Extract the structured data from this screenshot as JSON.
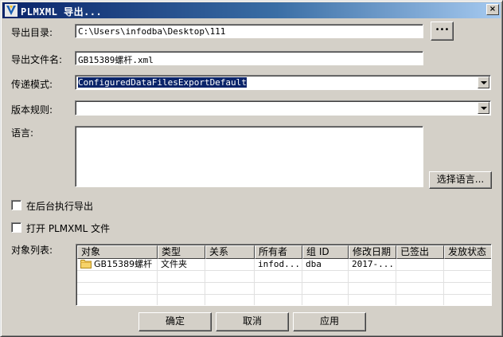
{
  "window": {
    "title": "PLMXML 导出...",
    "close_label": "×"
  },
  "form": {
    "export_dir_label": "导出目录:",
    "export_dir_value": "C:\\Users\\infodba\\Desktop\\111",
    "browse_label": "•••",
    "export_filename_label": "导出文件名:",
    "export_filename_value": "GB15389螺杆.xml",
    "transfer_mode_label": "传递模式:",
    "transfer_mode_value": "ConfiguredDataFilesExportDefault",
    "revision_rule_label": "版本规则:",
    "revision_rule_value": "",
    "language_label": "语言:",
    "select_language_label": "选择语言...",
    "background_checkbox_label": "在后台执行导出",
    "open_file_checkbox_label": "打开 PLMXML 文件",
    "object_list_label": "对象列表:"
  },
  "table": {
    "columns": [
      "对象",
      "类型",
      "关系",
      "所有者",
      "组 ID",
      "修改日期",
      "已签出",
      "发放状态"
    ],
    "rows": [
      [
        "GB15389螺杆",
        "文件夹",
        "",
        "infod...",
        "dba",
        "2017-...",
        "",
        ""
      ]
    ]
  },
  "buttons": {
    "ok": "确定",
    "cancel": "取消",
    "apply": "应用"
  }
}
